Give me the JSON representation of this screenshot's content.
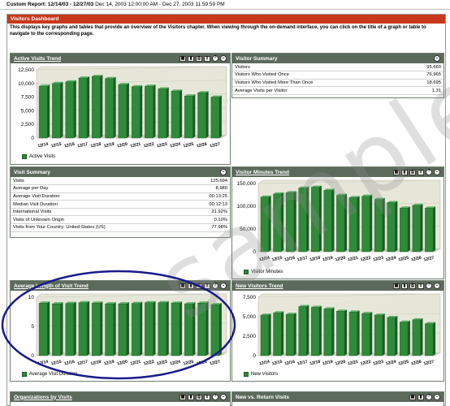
{
  "report": {
    "label": "Custom Report: 12/14/03 - 12/27/03",
    "range": "Dec 14, 2003 12:00:00 AM - Dec 27, 2003 11:59:59 PM"
  },
  "dashboard": {
    "title": "Visitors Dashboard",
    "description": "This displays key graphs and tables that provide an overview of the Visitors chapter. When viewing through the on-demand interface, you can click on the title of a graph or table to navigate to the corresponding page."
  },
  "watermark": "sample",
  "colors": {
    "bar": "#2f8a3a",
    "bar_dark": "#1c5a24",
    "panel_title": "#5c6a5c",
    "header_red": "#c8381a",
    "annotation": "#1a1a8c"
  },
  "icons": [
    "table-icon",
    "chart-icon",
    "print-icon",
    "export-icon",
    "help-icon",
    "collapse-icon"
  ],
  "panels": {
    "active_visits_trend": {
      "title": "Active Visits Trend",
      "legend": "Active Visits"
    },
    "visitor_summary": {
      "title": "Visitor Summary",
      "rows": [
        {
          "label": "Visitors",
          "value": "95,660"
        },
        {
          "label": "Visitors Who Visited Once",
          "value": "76,965"
        },
        {
          "label": "Visitors Who Visited More Than Once",
          "value": "18,695"
        },
        {
          "label": "Average Visits per Visitor",
          "value": "1.31"
        }
      ]
    },
    "visit_summary": {
      "title": "Visit Summary",
      "rows": [
        {
          "label": "Visits",
          "value": "125,694"
        },
        {
          "label": "Average per Day",
          "value": "8,980"
        },
        {
          "label": "Average Visit Duration",
          "value": "00:13:25"
        },
        {
          "label": "Median Visit Duration",
          "value": "00:12:13"
        },
        {
          "label": "International Visits",
          "value": "21.92%"
        },
        {
          "label": "Visits of Unknown Origin",
          "value": "0.10%"
        },
        {
          "label": "Visits from Your Country: United States (US)",
          "value": "77.98%"
        }
      ]
    },
    "visitor_minutes_trend": {
      "title": "Visitor Minutes Trend",
      "legend": "Visitor Minutes"
    },
    "average_length_trend": {
      "title": "Average Length of Visit Trend",
      "legend": "Average Visit Duration"
    },
    "new_visitors_trend": {
      "title": "New Visitors Trend",
      "legend": "New Visitors"
    },
    "organizations_by_visits": {
      "title": "Organizations by Visits"
    },
    "new_vs_return_visits": {
      "title": "New vs. Return Visits"
    }
  },
  "chart_data": [
    {
      "id": "active-visits",
      "type": "bar",
      "categories": [
        "12/14",
        "12/15",
        "12/16",
        "12/17",
        "12/18",
        "12/19",
        "12/20",
        "12/21",
        "12/22",
        "12/23",
        "12/24",
        "12/25",
        "12/26",
        "12/27"
      ],
      "series": [
        {
          "name": "Active Visits",
          "values": [
            9500,
            10000,
            10300,
            11000,
            11300,
            10900,
            9800,
            9400,
            9500,
            9000,
            8600,
            7700,
            8300,
            7500
          ]
        }
      ],
      "yticks": [
        "12,500",
        "10,000",
        "7,500",
        "5,000",
        "2,500",
        "0"
      ],
      "ylim": [
        0,
        12500
      ]
    },
    {
      "id": "visitor-minutes",
      "type": "bar",
      "categories": [
        "12/14",
        "12/15",
        "12/16",
        "12/17",
        "12/18",
        "12/19",
        "12/20",
        "12/21",
        "12/22",
        "12/23",
        "12/24",
        "12/25",
        "12/26",
        "12/27"
      ],
      "series": [
        {
          "name": "Visitor Minutes",
          "values": [
            120000,
            127000,
            130000,
            140000,
            142000,
            135000,
            124000,
            119000,
            122000,
            115000,
            108000,
            96000,
            102000,
            96000
          ]
        }
      ],
      "yticks": [
        "150,000",
        "100,000",
        "50,000",
        "0"
      ],
      "ylim": [
        0,
        150000
      ]
    },
    {
      "id": "average-length",
      "type": "bar",
      "categories": [
        "12/14",
        "12/15",
        "12/16",
        "12/17",
        "12/18",
        "12/19",
        "12/20",
        "12/21",
        "12/22",
        "12/23",
        "12/24",
        "12/25",
        "12/26",
        "12/27"
      ],
      "series": [
        {
          "name": "Average Visit Duration",
          "values": [
            13.5,
            13.3,
            13.4,
            13.6,
            13.5,
            13.3,
            13.3,
            13.4,
            13.6,
            13.6,
            13.5,
            13.3,
            13.5,
            13.1
          ]
        }
      ],
      "yticks": [
        "10",
        "5",
        "0"
      ],
      "ylim": [
        0,
        15
      ]
    },
    {
      "id": "new-visitors",
      "type": "bar",
      "categories": [
        "12/14",
        "12/15",
        "12/16",
        "12/17",
        "12/18",
        "12/19",
        "12/20",
        "12/21",
        "12/22",
        "12/23",
        "12/24",
        "12/25",
        "12/26",
        "12/27"
      ],
      "series": [
        {
          "name": "New Visitors",
          "values": [
            5200,
            5500,
            5300,
            6300,
            6200,
            6000,
            5700,
            5600,
            5400,
            5200,
            4900,
            4300,
            4600,
            4100
          ]
        }
      ],
      "yticks": [
        "7,500",
        "5,000",
        "2,500",
        "0"
      ],
      "ylim": [
        0,
        7500
      ]
    }
  ]
}
